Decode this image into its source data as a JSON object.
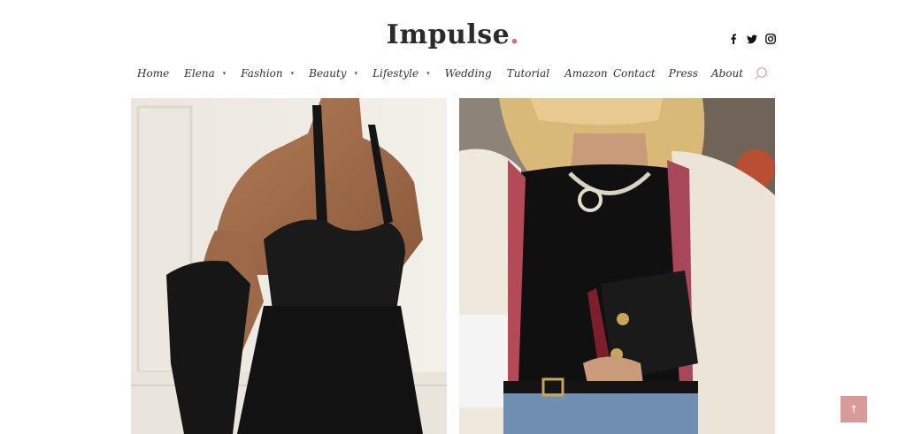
{
  "header": {
    "logo_text": "Impulse",
    "logo_dot": ".",
    "social_icons": [
      "facebook-icon",
      "twitter-icon",
      "instagram-icon"
    ]
  },
  "nav": {
    "left_items": [
      {
        "label": "Home",
        "has_submenu": false
      },
      {
        "label": "Elena",
        "has_submenu": true
      },
      {
        "label": "Fashion",
        "has_submenu": true
      },
      {
        "label": "Beauty",
        "has_submenu": true
      },
      {
        "label": "Lifestyle",
        "has_submenu": true
      },
      {
        "label": "Wedding",
        "has_submenu": false
      },
      {
        "label": "Tutorial",
        "has_submenu": false
      },
      {
        "label": "Amazon",
        "has_submenu": false
      }
    ],
    "right_items": [
      "Contact",
      "Press",
      "About"
    ],
    "caret": "▾"
  },
  "posts": {
    "left_image_alt": "model in black halter knit top",
    "right_image_alt": "woman in tweed jacket with quilted bag"
  },
  "scroll_top": {
    "label": "↑"
  },
  "colors": {
    "accent": "#d06b86",
    "scroll_top_bg": "#d99a9a",
    "text": "#333333"
  }
}
